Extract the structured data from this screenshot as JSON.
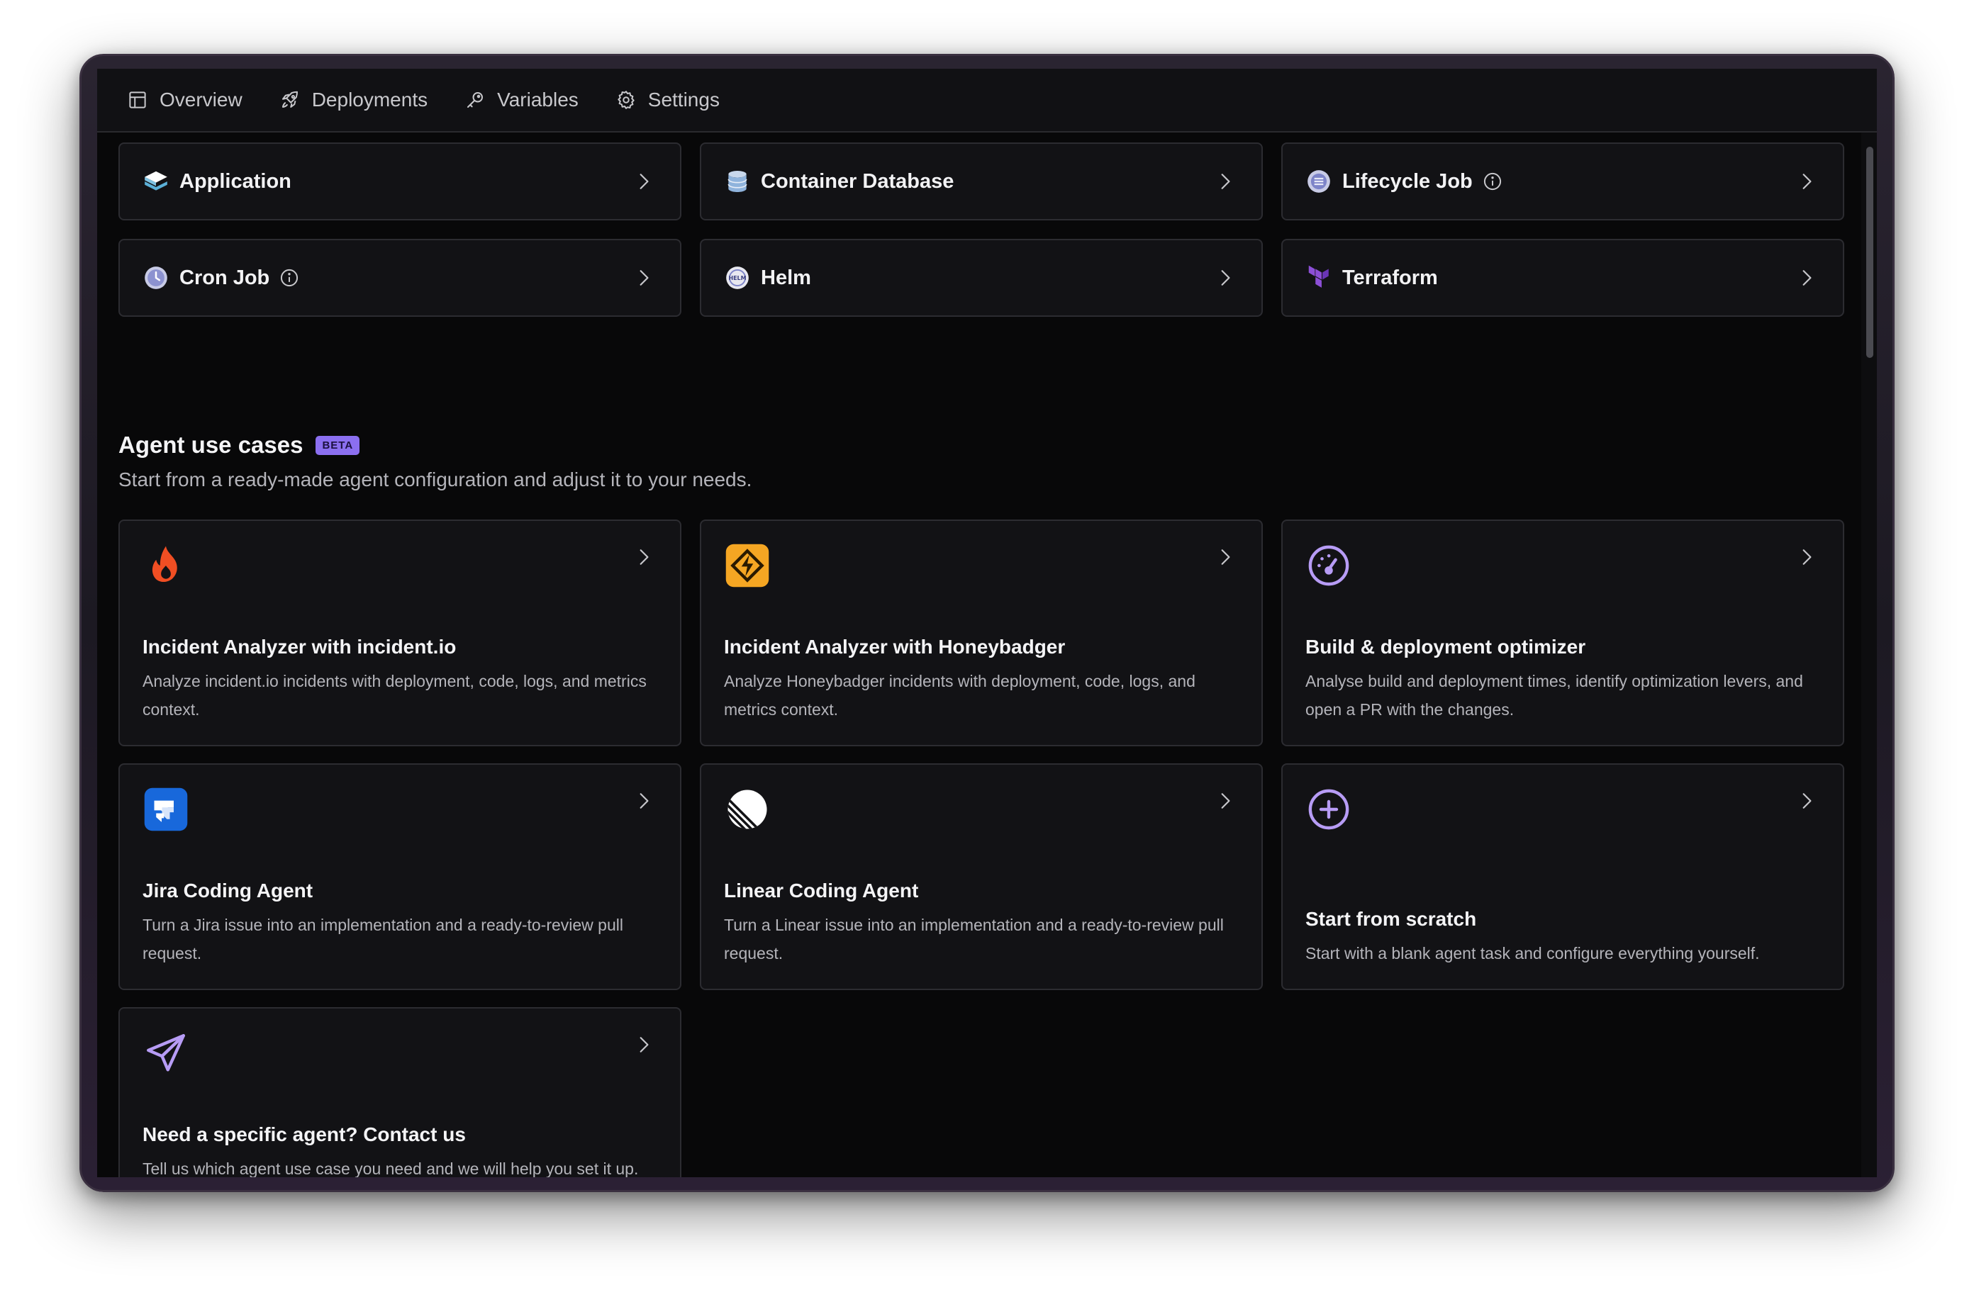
{
  "nav": {
    "items": [
      {
        "label": "Overview",
        "icon": "layout-icon"
      },
      {
        "label": "Deployments",
        "icon": "rocket-icon"
      },
      {
        "label": "Variables",
        "icon": "key-icon"
      },
      {
        "label": "Settings",
        "icon": "gear-icon"
      }
    ]
  },
  "types": [
    {
      "label": "Application",
      "icon": "layers-icon"
    },
    {
      "label": "Container Database",
      "icon": "database-icon"
    },
    {
      "label": "Lifecycle Job",
      "icon": "lifecycle-icon"
    },
    {
      "label": "Cron Job",
      "icon": "clock-icon"
    },
    {
      "label": "Helm",
      "icon": "helm-icon"
    },
    {
      "label": "Terraform",
      "icon": "terraform-icon"
    }
  ],
  "agents_section": {
    "title": "Agent use cases",
    "badge": "BETA",
    "subtitle": "Start from a ready-made agent configuration and adjust it to your needs."
  },
  "agents": [
    {
      "title": "Incident Analyzer with incident.io",
      "description": "Analyze incident.io incidents with deployment, code, logs, and metrics context.",
      "icon": "flame-icon"
    },
    {
      "title": "Incident Analyzer with Honeybadger",
      "description": "Analyze Honeybadger incidents with deployment, code, logs, and metrics context.",
      "icon": "honeybadger-icon"
    },
    {
      "title": "Build & deployment optimizer",
      "description": "Analyse build and deployment times, identify optimization levers, and open a PR with the changes.",
      "icon": "gauge-icon"
    },
    {
      "title": "Jira Coding Agent",
      "description": "Turn a Jira issue into an implementation and a ready-to-review pull request.",
      "icon": "jira-icon"
    },
    {
      "title": "Linear Coding Agent",
      "description": "Turn a Linear issue into an implementation and a ready-to-review pull request.",
      "icon": "linear-icon"
    },
    {
      "title": "Start from scratch",
      "description": "Start with a blank agent task and configure everything yourself.",
      "icon": "plus-circle-icon"
    },
    {
      "title": "Need a specific agent? Contact us",
      "description": "Tell us which agent use case you need and we will help you set it up.",
      "icon": "send-icon"
    }
  ],
  "colors": {
    "accent": "#8b6ff0",
    "background": "#080809",
    "card": "#121215",
    "border": "#2c2c31"
  }
}
